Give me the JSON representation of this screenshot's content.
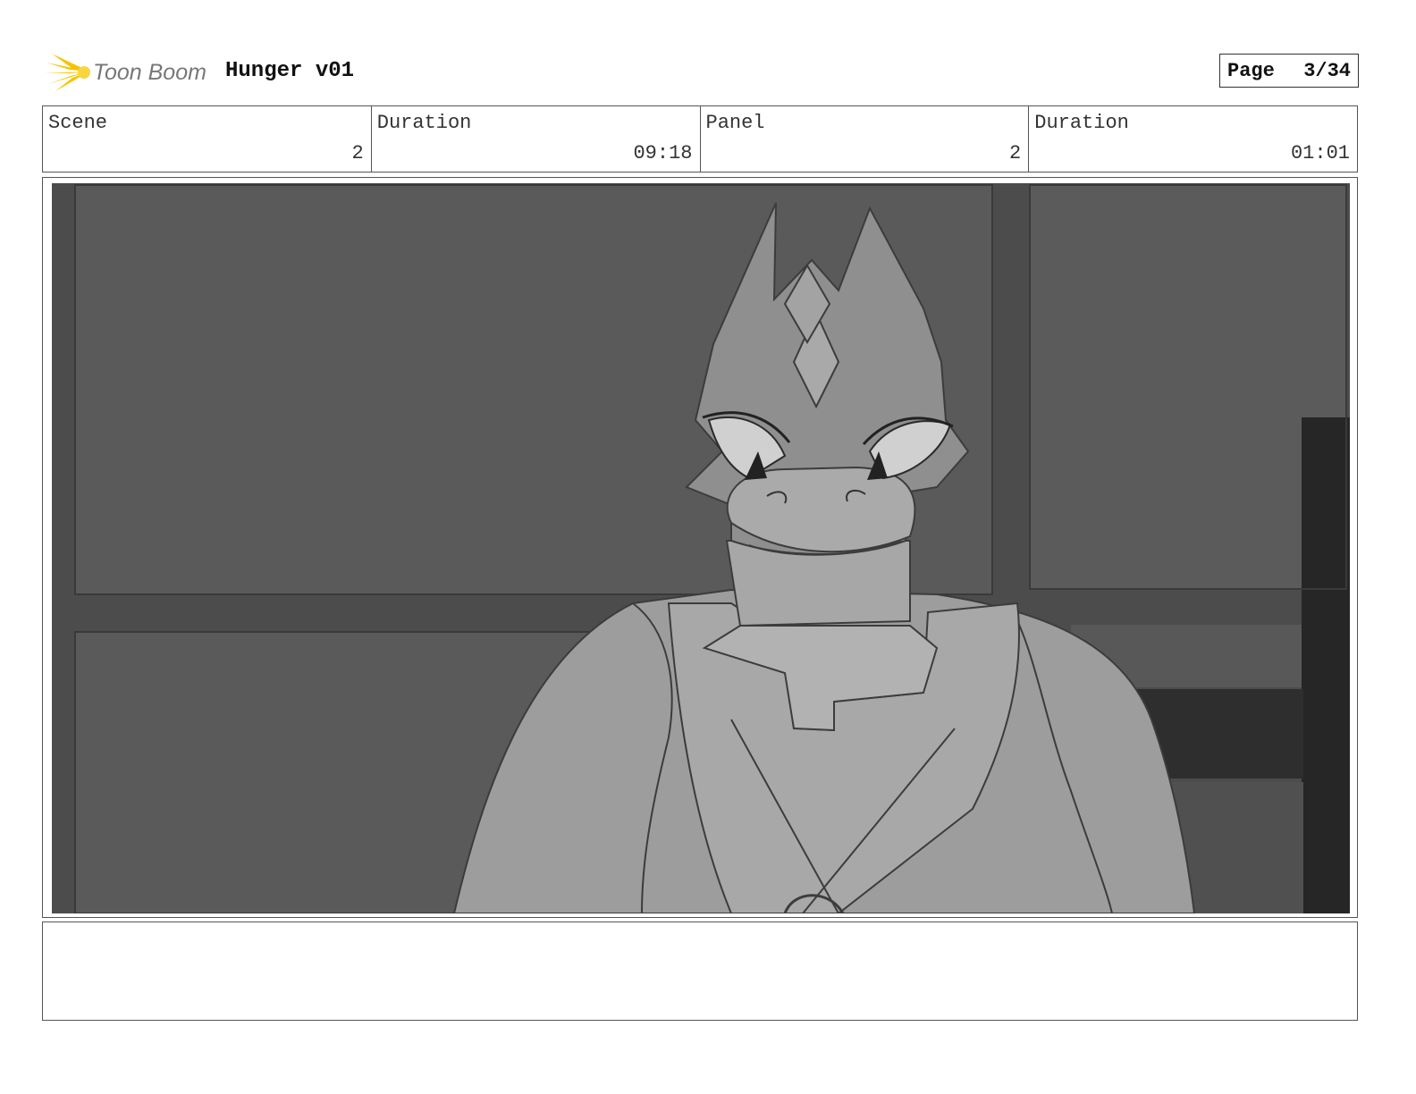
{
  "header": {
    "logo_text": "Toon Boom",
    "title": "Hunger v01",
    "page_label": "Page",
    "page_value": "3/34"
  },
  "info": {
    "scene_label": "Scene",
    "scene_value": "2",
    "scene_duration_label": "Duration",
    "scene_duration_value": "09:18",
    "panel_label": "Panel",
    "panel_value": "2",
    "panel_duration_label": "Duration",
    "panel_duration_value": "01:01"
  },
  "panel": {
    "illustration": "storyboard-sketch",
    "notes": ""
  },
  "colors": {
    "logo_accent": "#f5c400",
    "background_gray": "#5a5a5a",
    "character_gray": "#9a9a9a"
  }
}
